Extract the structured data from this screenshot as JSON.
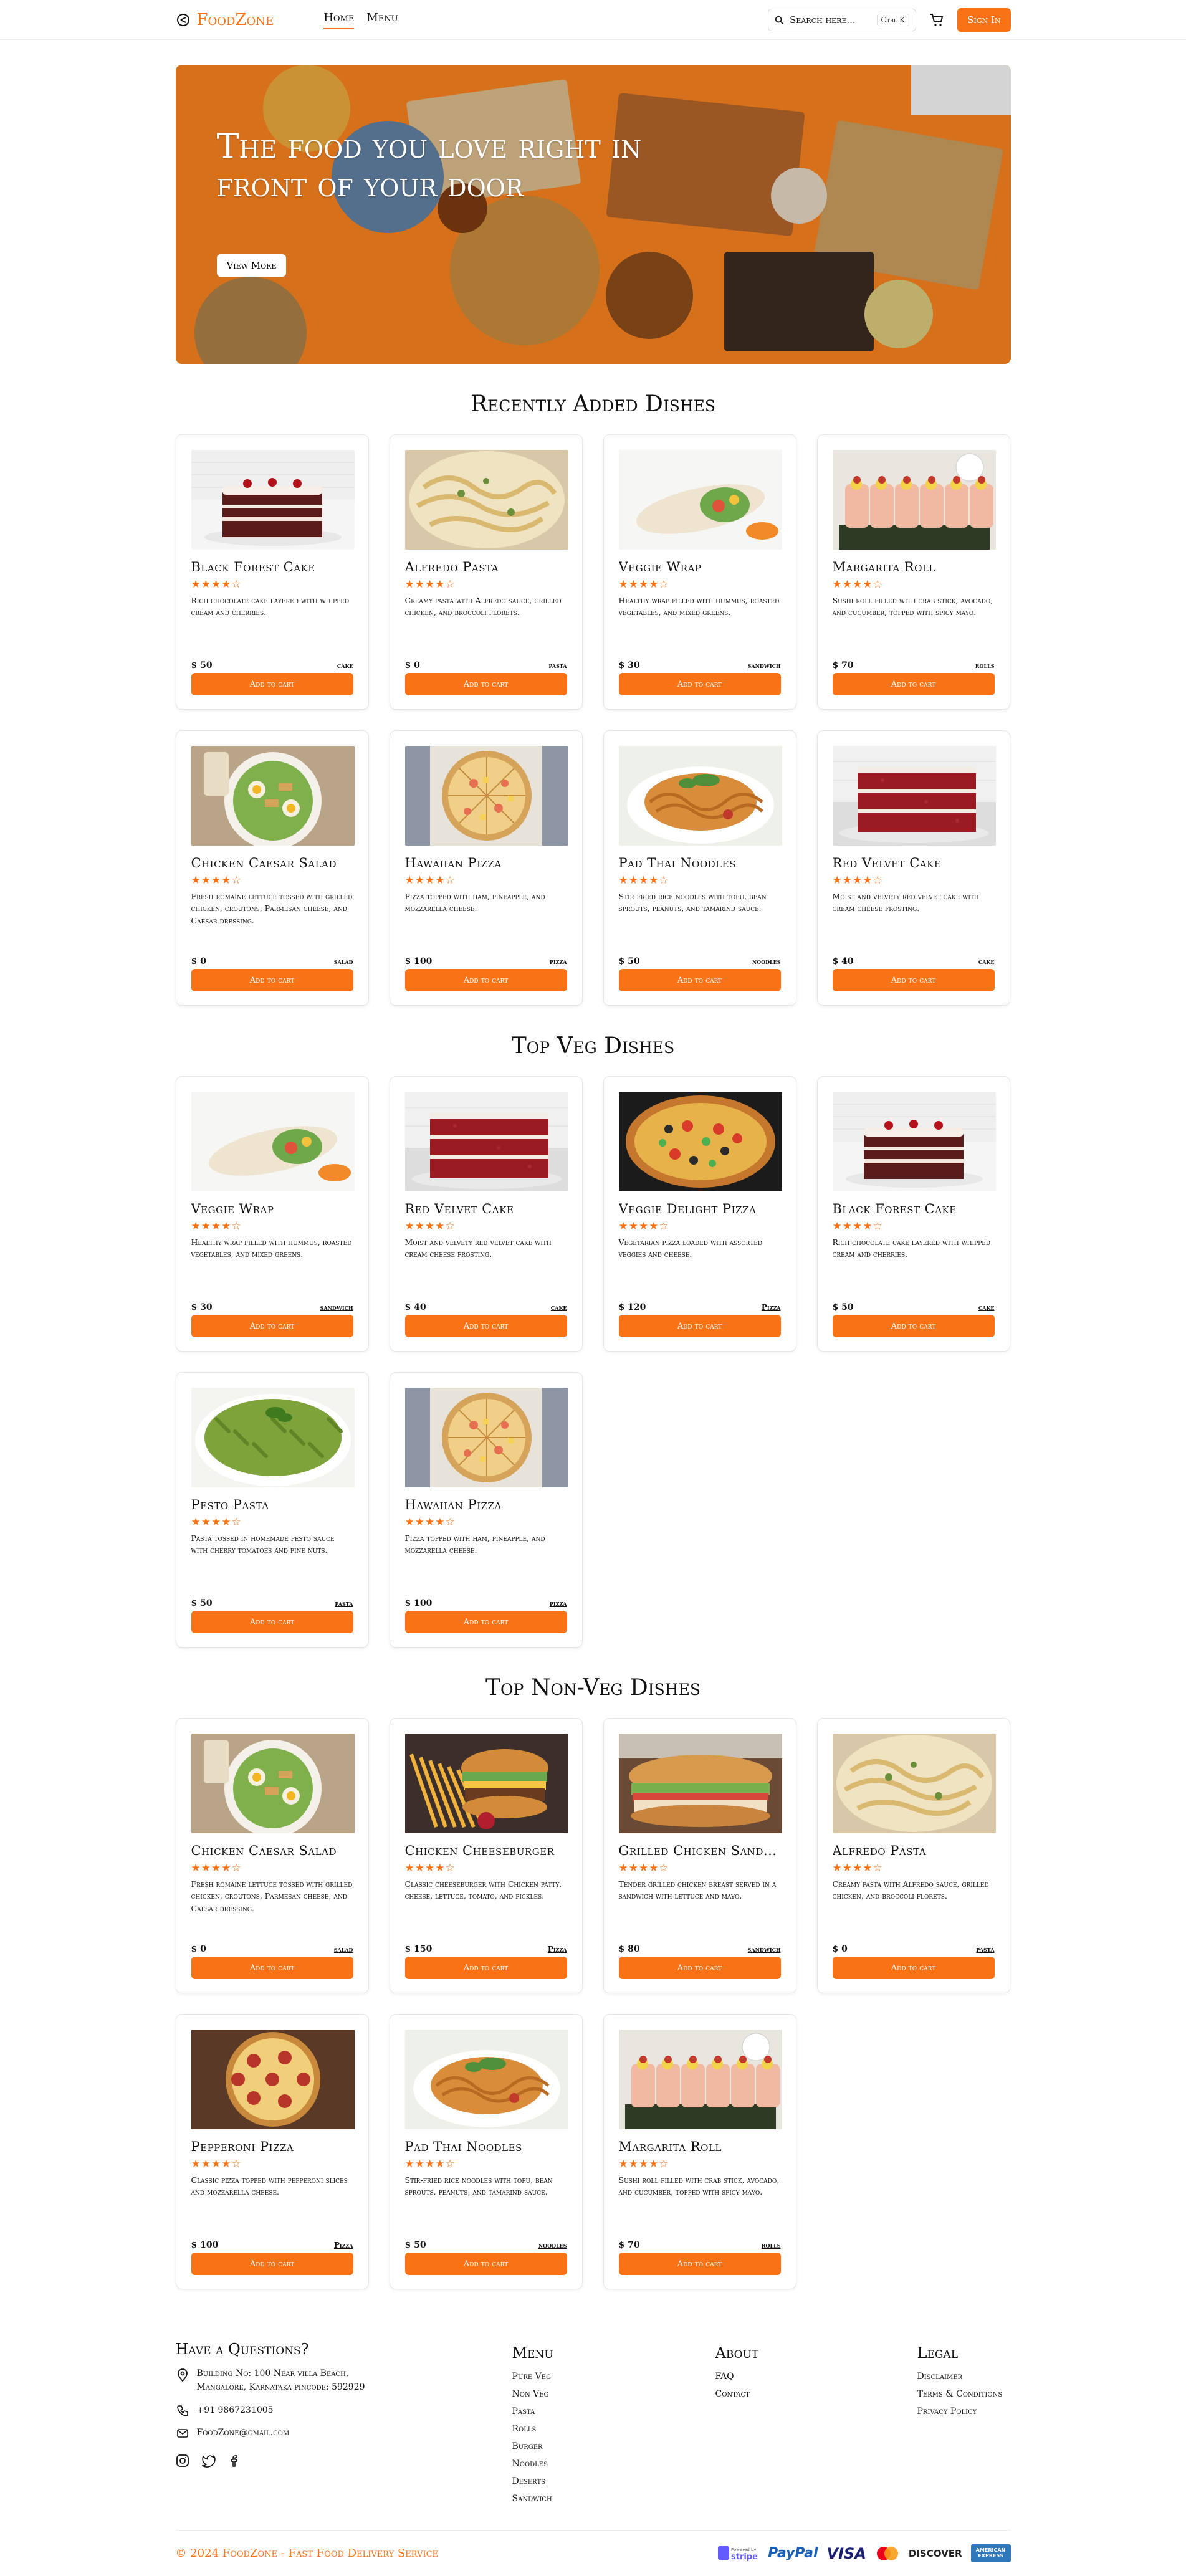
{
  "header": {
    "logo": "FoodZone",
    "nav": [
      {
        "label": "Home",
        "active": true
      },
      {
        "label": "Menu",
        "active": false
      }
    ],
    "search_placeholder": "Search here...",
    "search_shortcut": "Ctrl K",
    "signin": "Sign In"
  },
  "hero": {
    "title": "The food you love right in front of your door",
    "button": "View More"
  },
  "sections": [
    {
      "title": "Recently Added Dishes",
      "items": [
        {
          "name": "Black Forest Cake",
          "rating": 4,
          "desc": "Rich chocolate cake layered with whipped cream and cherries.",
          "price": "$ 50",
          "category": "cake",
          "img": "cake"
        },
        {
          "name": "Alfredo Pasta",
          "rating": 4,
          "desc": "Creamy pasta with Alfredo sauce, grilled chicken, and broccoli florets.",
          "price": "$ 0",
          "category": "pasta",
          "img": "alfredo"
        },
        {
          "name": "Veggie Wrap",
          "rating": 4,
          "desc": "Healthy wrap filled with hummus, roasted vegetables, and mixed greens.",
          "price": "$ 30",
          "category": "sandwich",
          "img": "wrap"
        },
        {
          "name": "Margarita Roll",
          "rating": 4,
          "desc": "Sushi roll filled with crab stick, avocado, and cucumber, topped with spicy mayo.",
          "price": "$ 70",
          "category": "rolls",
          "img": "sushi"
        },
        {
          "name": "Chicken Caesar Salad",
          "rating": 4,
          "desc": "Fresh romaine lettuce tossed with grilled chicken, croutons, Parmesan cheese, and Caesar dressing.",
          "price": "$ 0",
          "category": "salad",
          "img": "salad"
        },
        {
          "name": "Hawaiian Pizza",
          "rating": 4,
          "desc": "Pizza topped with ham, pineapple, and mozzarella cheese.",
          "price": "$ 100",
          "category": "pizza",
          "img": "hawaiian"
        },
        {
          "name": "Pad Thai Noodles",
          "rating": 4,
          "desc": "Stir-fried rice noodles with tofu, bean sprouts, peanuts, and tamarind sauce.",
          "price": "$ 50",
          "category": "noodles",
          "img": "noodles"
        },
        {
          "name": "Red Velvet Cake",
          "rating": 4,
          "desc": "Moist and velvety red velvet cake with cream cheese frosting.",
          "price": "$ 40",
          "category": "cake",
          "img": "redvelvet"
        }
      ]
    },
    {
      "title": "Top Veg Dishes",
      "items": [
        {
          "name": "Veggie Wrap",
          "rating": 4,
          "desc": "Healthy wrap filled with hummus, roasted vegetables, and mixed greens.",
          "price": "$ 30",
          "category": "sandwich",
          "img": "wrap"
        },
        {
          "name": "Red Velvet Cake",
          "rating": 4,
          "desc": "Moist and velvety red velvet cake with cream cheese frosting.",
          "price": "$ 40",
          "category": "cake",
          "img": "redvelvet"
        },
        {
          "name": "Veggie Delight Pizza",
          "rating": 4,
          "desc": "Vegetarian pizza loaded with assorted veggies and cheese.",
          "price": "$ 120",
          "category": "Pizza",
          "img": "vegpizza"
        },
        {
          "name": "Black Forest Cake",
          "rating": 4,
          "desc": "Rich chocolate cake layered with whipped cream and cherries.",
          "price": "$ 50",
          "category": "cake",
          "img": "cake"
        },
        {
          "name": "Pesto Pasta",
          "rating": 4,
          "desc": "Pasta tossed in homemade pesto sauce with cherry tomatoes and pine nuts.",
          "price": "$ 50",
          "category": "pasta",
          "img": "pesto"
        },
        {
          "name": "Hawaiian Pizza",
          "rating": 4,
          "desc": "Pizza topped with ham, pineapple, and mozzarella cheese.",
          "price": "$ 100",
          "category": "pizza",
          "img": "hawaiian"
        }
      ]
    },
    {
      "title": "Top Non-Veg Dishes",
      "items": [
        {
          "name": "Chicken Caesar Salad",
          "rating": 4,
          "desc": "Fresh romaine lettuce tossed with grilled chicken, croutons, Parmesan cheese, and Caesar dressing.",
          "price": "$ 0",
          "category": "salad",
          "img": "salad"
        },
        {
          "name": "Chicken Cheeseburger",
          "rating": 4,
          "desc": "Classic cheeseburger with Chicken patty, cheese, lettuce, tomato, and pickles.",
          "price": "$ 150",
          "category": "Pizza",
          "img": "burger"
        },
        {
          "name": "Grilled Chicken Sand...",
          "rating": 4,
          "desc": "Tender grilled chicken breast served in a sandwich with lettuce and mayo.",
          "price": "$ 80",
          "category": "sandwich",
          "img": "sandwich"
        },
        {
          "name": "Alfredo Pasta",
          "rating": 4,
          "desc": "Creamy pasta with Alfredo sauce, grilled chicken, and broccoli florets.",
          "price": "$ 0",
          "category": "pasta",
          "img": "alfredo"
        },
        {
          "name": "Pepperoni Pizza",
          "rating": 4,
          "desc": "Classic pizza topped with pepperoni slices and mozzarella cheese.",
          "price": "$ 100",
          "category": "Pizza",
          "img": "pepperoni"
        },
        {
          "name": "Pad Thai Noodles",
          "rating": 4,
          "desc": "Stir-fried rice noodles with tofu, bean sprouts, peanuts, and tamarind sauce.",
          "price": "$ 50",
          "category": "noodles",
          "img": "noodles"
        },
        {
          "name": "Margarita Roll",
          "rating": 4,
          "desc": "Sushi roll filled with crab stick, avocado, and cucumber, topped with spicy mayo.",
          "price": "$ 70",
          "category": "rolls",
          "img": "sushi"
        }
      ]
    }
  ],
  "add_to_cart": "Add to cart",
  "footer": {
    "contact_title": "Have a Questions?",
    "address": "Building No: 100 Near villa Beach, Mangalore, Karnataka pincode: 592929",
    "phone": "+91 9867231005",
    "email": "FoodZone@gmail.com",
    "menu_title": "Menu",
    "menu_links": [
      "Pure Veg",
      "Non Veg",
      "Pasta",
      "Rolls",
      "Burger",
      "Noodles",
      "Deserts",
      "Sandwich"
    ],
    "about_title": "About",
    "about_links": [
      "FAQ",
      "Contact"
    ],
    "legal_title": "Legal",
    "legal_links": [
      "Disclaimer",
      "Terms & Conditions",
      "Privacy Policy"
    ],
    "copyright": "© 2024 FoodZone - Fast Food Delivery Service",
    "payments": [
      "Powered by stripe",
      "PayPal",
      "VISA",
      "mastercard",
      "DISCOVER",
      "AMERICAN EXPRESS"
    ]
  },
  "colors": {
    "accent": "#f97316"
  }
}
